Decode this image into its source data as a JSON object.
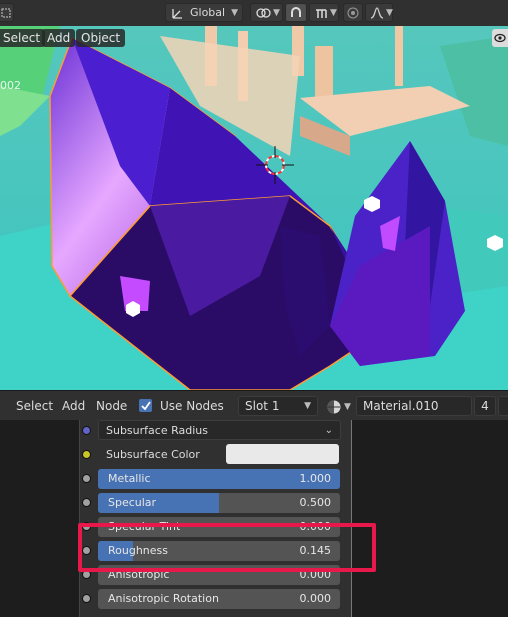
{
  "topbar": {
    "orientation_label": "Global",
    "icons": [
      "object-mode-icon",
      "transform-orientation-icon",
      "pivot-icon",
      "snap-icon",
      "snap-increment-icon",
      "proportional-edit-icon",
      "falloff-curve-icon"
    ]
  },
  "viewport": {
    "menu": {
      "select": "Select",
      "add": "Add",
      "object": "Object"
    },
    "object_tag": "002"
  },
  "node_header": {
    "menu": {
      "select": "Select",
      "add": "Add",
      "node": "Node"
    },
    "use_nodes_label": "Use Nodes",
    "use_nodes_checked": true,
    "slot": "Slot 1",
    "material_name": "Material.010",
    "user_count": "4"
  },
  "node": {
    "subsurface_radius": "Subsurface Radius",
    "subsurface_color": "Subsurface Color",
    "metallic": {
      "label": "Metallic",
      "value": "1.000",
      "level": 1.0
    },
    "specular": {
      "label": "Specular",
      "value": "0.500",
      "level": 0.5
    },
    "specular_tint": {
      "label": "Specular Tint",
      "value": "0.000"
    },
    "roughness": {
      "label": "Roughness",
      "value": "0.145",
      "level": 0.145
    },
    "anisotropic": {
      "label": "Anisotropic",
      "value": "0.000"
    },
    "anisotropic_rotation": {
      "label": "Anisotropic Rotation",
      "value": "0.000"
    }
  },
  "colors": {
    "accent": "#4772b3",
    "highlight": "#e8194a",
    "socket_vector": "#6363c7",
    "socket_color": "#c7c729",
    "socket_float": "#a1a1a1"
  }
}
